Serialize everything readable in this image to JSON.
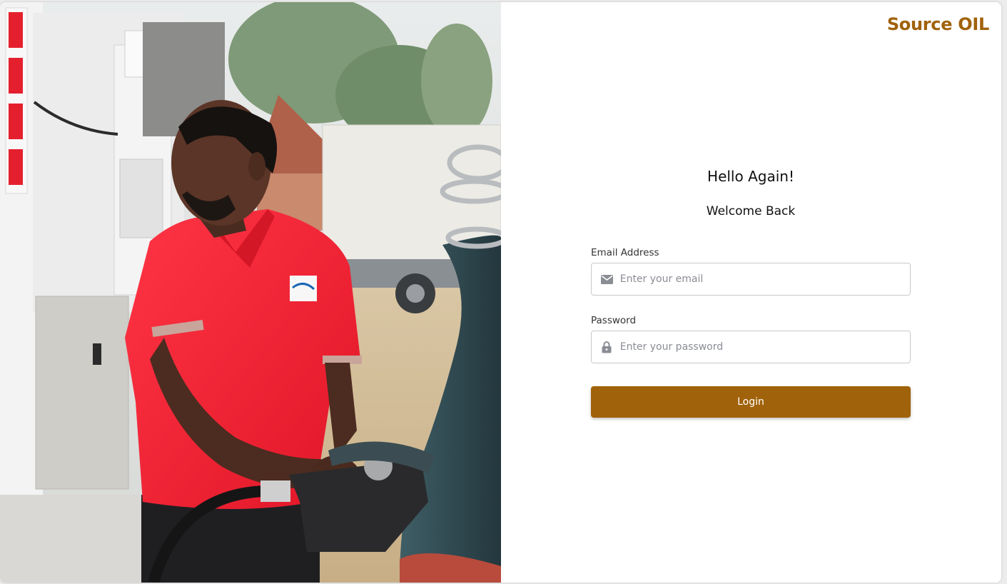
{
  "brand": {
    "name": "Source OIL",
    "color": "#a0620a"
  },
  "hero_image": {
    "description_icon": "fuel-attendant-photo"
  },
  "login": {
    "title": "Hello Again!",
    "subtitle": "Welcome Back",
    "email": {
      "label": "Email Address",
      "placeholder": "Enter your email",
      "value": "",
      "icon": "mail-icon"
    },
    "password": {
      "label": "Password",
      "placeholder": "Enter your password",
      "value": "",
      "icon": "lock-icon"
    },
    "submit_label": "Login"
  }
}
